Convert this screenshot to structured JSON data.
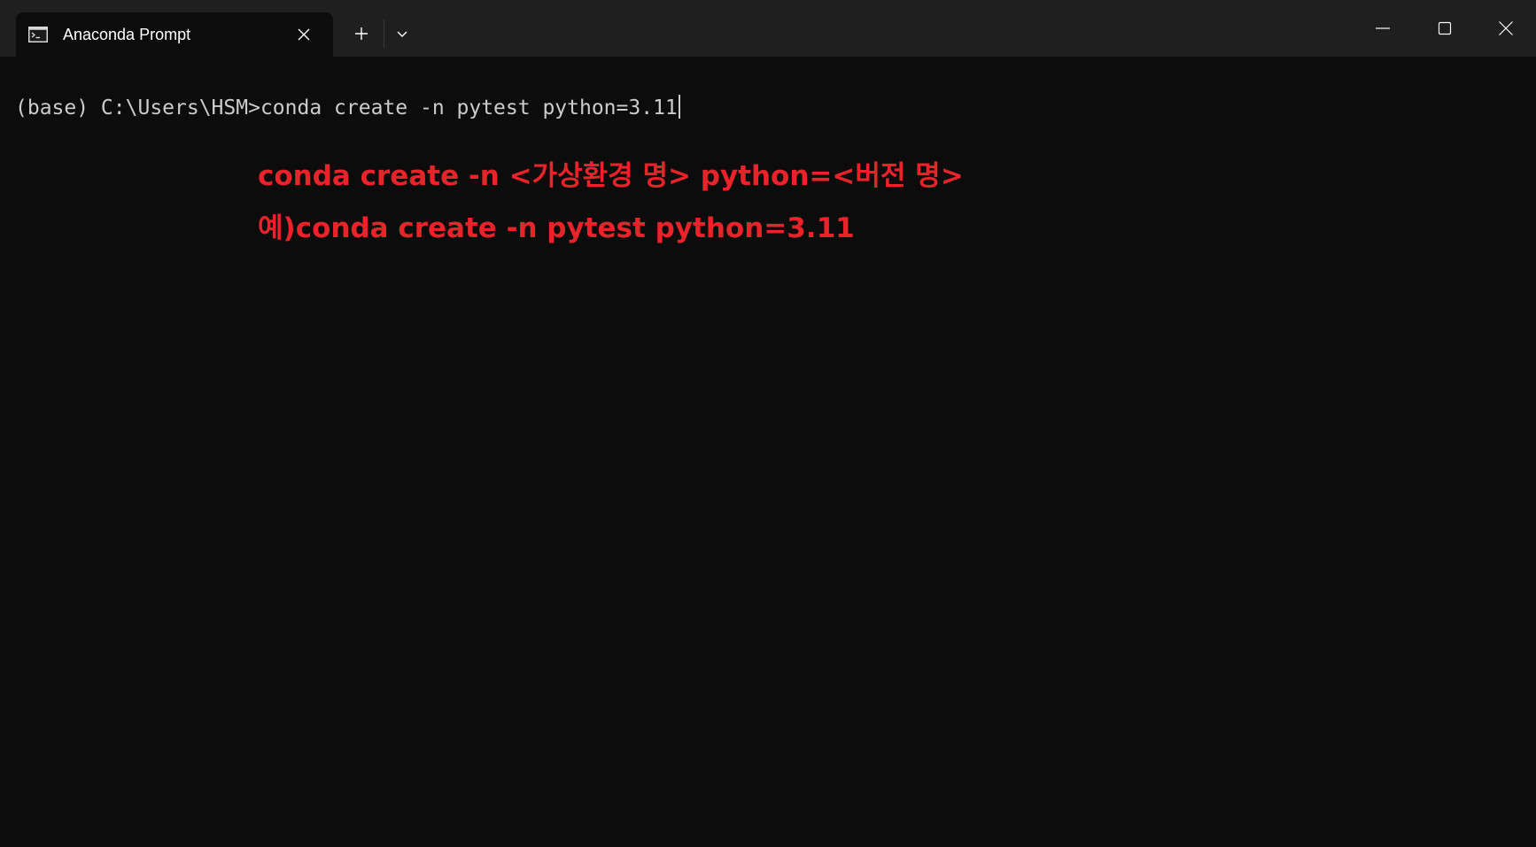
{
  "window": {
    "tab_title": "Anaconda Prompt",
    "tab_icon": "terminal-icon",
    "new_tab_icon": "plus-icon",
    "dropdown_icon": "chevron-down-icon",
    "controls": [
      "minimize-icon",
      "maximize-icon",
      "close-icon"
    ]
  },
  "terminal": {
    "prompt": "(base) C:\\Users\\HSM>",
    "command": "conda create -n pytest python=3.11",
    "text_color": "#cccccc",
    "background": "#0c0c0c"
  },
  "annotations": {
    "line1": "conda create -n <가상환경 명> python=<버전 명>",
    "line2": "예)conda create -n pytest python=3.11",
    "color": "#e8232a"
  }
}
